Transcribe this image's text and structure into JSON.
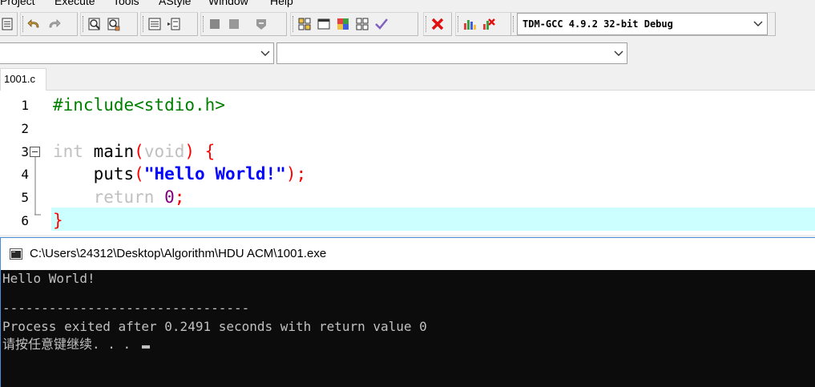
{
  "menu": [
    "Project",
    "Execute",
    "Tools",
    "AStyle",
    "Window",
    "Help"
  ],
  "toolbar": {
    "compiler": "TDM-GCC 4.9.2 32-bit Debug"
  },
  "icons": {
    "undo": "undo-icon",
    "redo": "redo-icon",
    "find": "find-icon",
    "replace": "replace-icon",
    "compile": "compile-icon",
    "run": "run-icon",
    "check": "check-syntax-icon",
    "stop": "stop-icon",
    "chart": "profile-chart-icon",
    "debug": "debug-icon"
  },
  "tab": {
    "label": "1001.c"
  },
  "editor": {
    "line_numbers": [
      "1",
      "2",
      "3",
      "4",
      "5",
      "6"
    ],
    "l1": "#include<stdio.h>",
    "l3_type": "int",
    "l3_name": " main",
    "l3_open": "(",
    "l3_void": "void",
    "l3_close": ") {",
    "l4_indent": "    ",
    "l4_call": "puts",
    "l4_open": "(",
    "l4_str": "\"Hello World!\"",
    "l4_close": ");",
    "l5_indent": "    ",
    "l5_kw": "return",
    "l5_sp": " ",
    "l5_num": "0",
    "l5_semi": ";",
    "l6": "}"
  },
  "console": {
    "title": "C:\\Users\\24312\\Desktop\\Algorithm\\HDU ACM\\1001.exe",
    "line1": "Hello World!",
    "line2": "--------------------------------",
    "line3": "Process exited after 0.2491 seconds with return value 0",
    "line4": "请按任意键继续. . . "
  },
  "colors": {
    "current_line": "#ccffff",
    "console_bg": "#0c0c0c",
    "console_text": "#c0c0c0"
  }
}
